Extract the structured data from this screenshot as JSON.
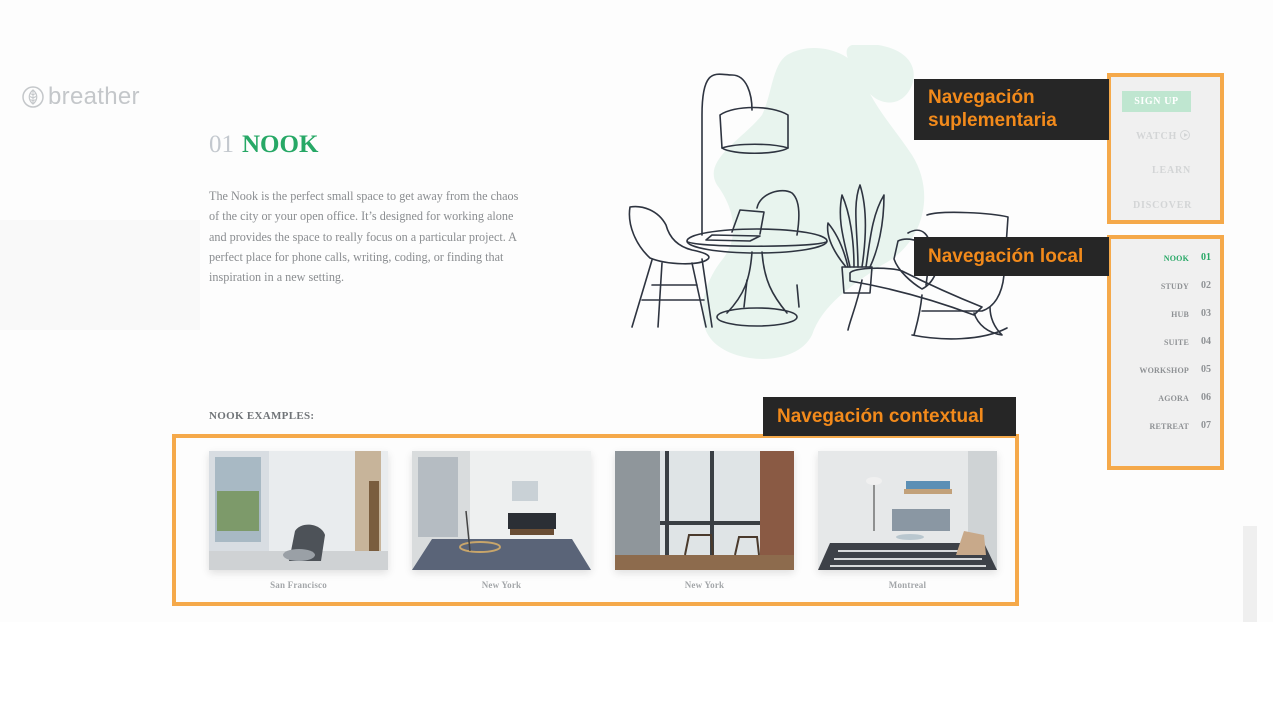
{
  "brand": {
    "logo_text": "breather",
    "logo_icon": "leaf-circle-icon"
  },
  "section": {
    "number": "01",
    "name": "NOOK",
    "description": "The Nook is the perfect small space to get away from the chaos of the city or your open office. It’s designed for working alone and provides the space to really focus on a particular project. A perfect place for phone calls, writing, coding, or finding that inspiration in a new setting.",
    "examples_title": "NOOK EXAMPLES:"
  },
  "examples": [
    {
      "location": "San Francisco"
    },
    {
      "location": "New York"
    },
    {
      "location": "New York"
    },
    {
      "location": "Montreal"
    }
  ],
  "supplementary_nav": {
    "signup": "SIGN UP",
    "watch": "WATCH",
    "learn": "LEARN",
    "discover": "DISCOVER"
  },
  "local_nav": [
    {
      "label": "NOOK",
      "num": "01",
      "active": true
    },
    {
      "label": "STUDY",
      "num": "02"
    },
    {
      "label": "HUB",
      "num": "03"
    },
    {
      "label": "SUITE",
      "num": "04"
    },
    {
      "label": "WORKSHOP",
      "num": "05"
    },
    {
      "label": "AGORA",
      "num": "06"
    },
    {
      "label": "RETREAT",
      "num": "07"
    }
  ],
  "annotations": {
    "supplementary": "Navegación suplementaria",
    "local": "Navegación local",
    "contextual": "Navegación contextual"
  },
  "colors": {
    "accent_green": "#27a866",
    "annotation_orange": "#f5a94a",
    "annotation_text": "#f28a1b",
    "annotation_bg": "#262626"
  }
}
